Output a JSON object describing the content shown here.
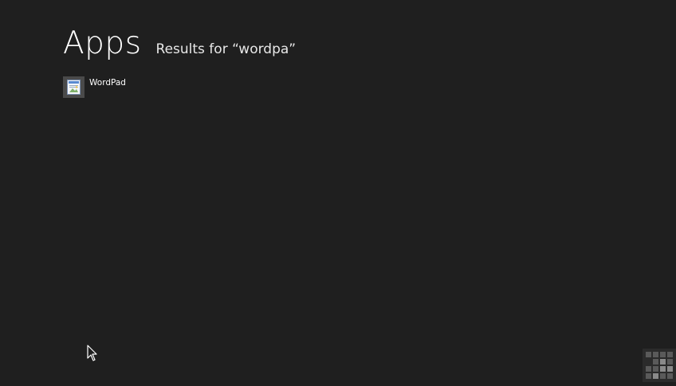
{
  "header": {
    "title": "Apps",
    "results_label": "Results for “wordpa”"
  },
  "results": [
    {
      "label": "WordPad",
      "icon": "wordpad-icon"
    }
  ],
  "overlay": {
    "cursor_icon": "mouse-pointer-icon",
    "zoom_icon": "semantic-zoom-icon"
  },
  "colors": {
    "background": "#1f1f1f",
    "tile": "#4a4a4a",
    "text": "#ffffff"
  }
}
